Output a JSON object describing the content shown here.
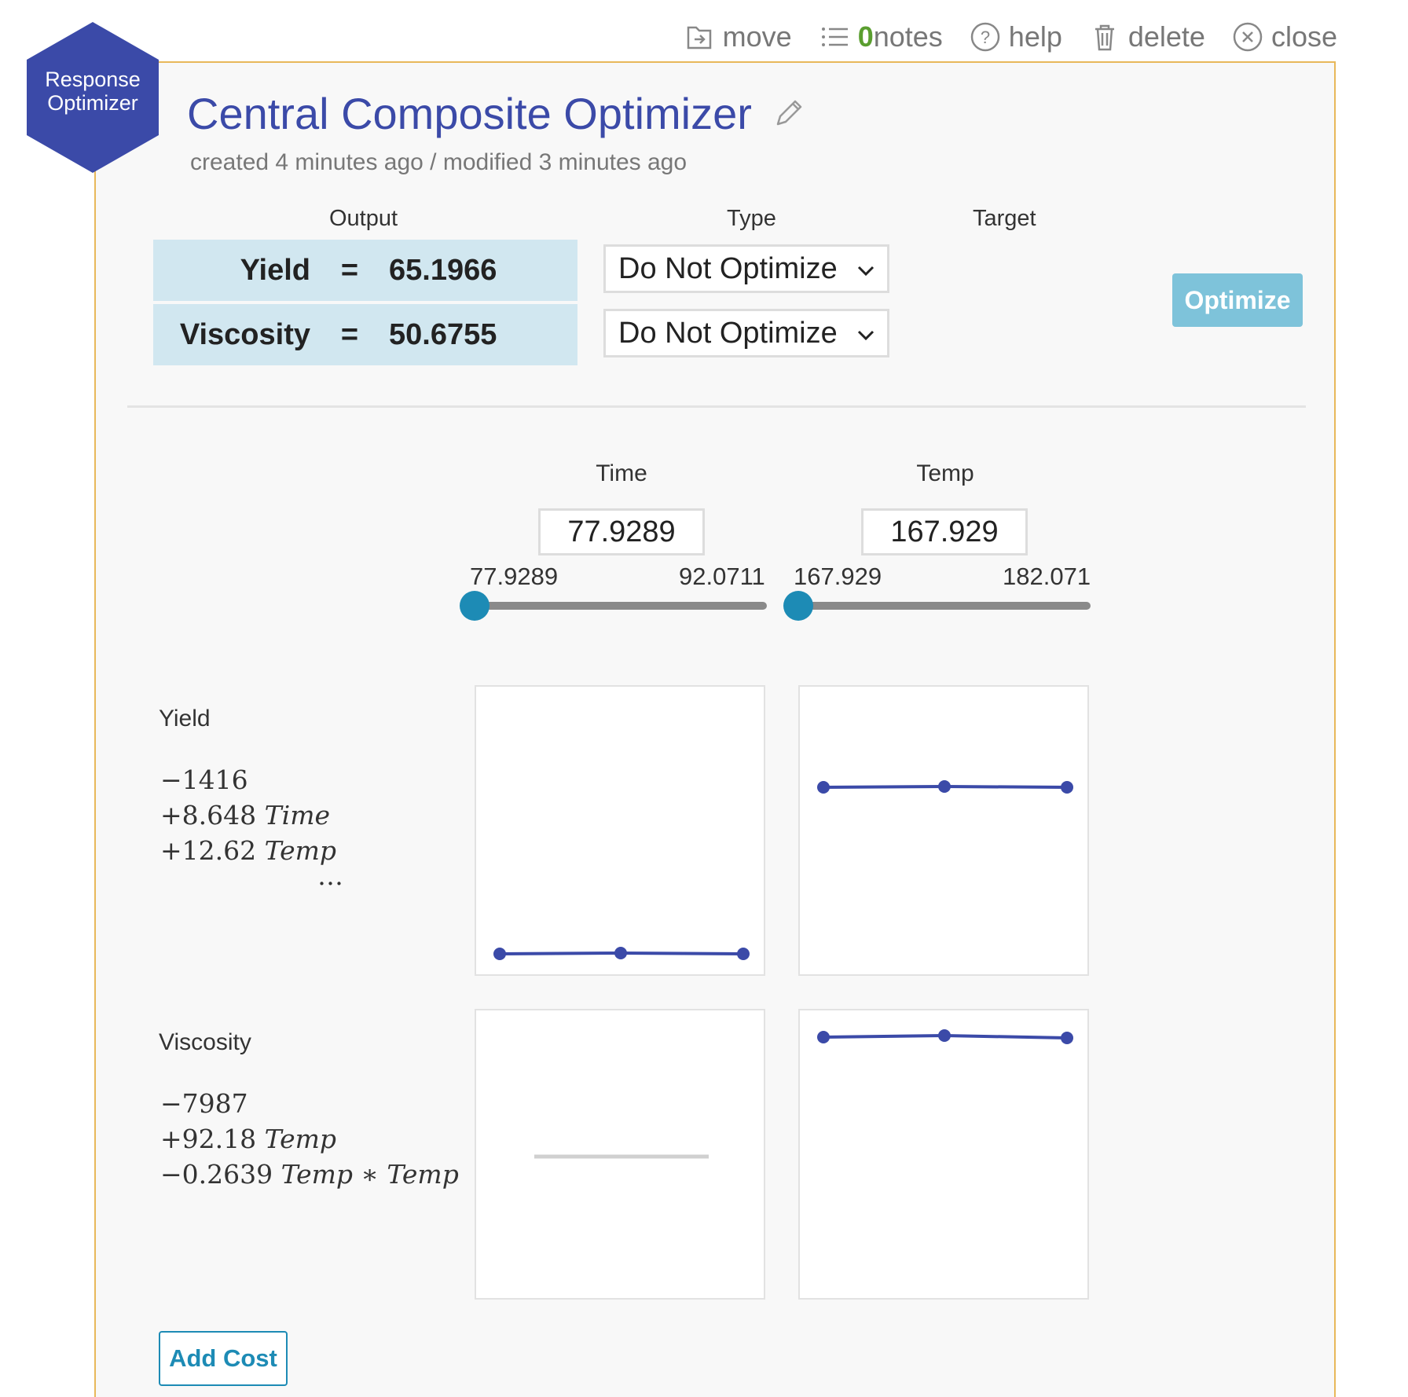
{
  "toolbar": {
    "move": "move",
    "notes_count": "0",
    "notes": "notes",
    "help": "help",
    "delete": "delete",
    "close": "close"
  },
  "badge": {
    "line1": "Response",
    "line2": "Optimizer",
    "icon": "wrench-icon",
    "color": "#3b4aa8"
  },
  "title": "Central Composite Optimizer",
  "subtitle": "created 4 minutes ago / modified 3 minutes ago",
  "headers": {
    "output": "Output",
    "type": "Type",
    "target": "Target"
  },
  "outputs": [
    {
      "name": "Yield",
      "eq": "=",
      "value": "65.1966",
      "type": "Do Not Optimize"
    },
    {
      "name": "Viscosity",
      "eq": "=",
      "value": "50.6755",
      "type": "Do Not Optimize"
    }
  ],
  "optimize_label": "Optimize",
  "factors": [
    {
      "name": "Time",
      "value": "77.9289",
      "min": "77.9289",
      "max": "92.0711",
      "position": 0
    },
    {
      "name": "Temp",
      "value": "167.929",
      "min": "167.929",
      "max": "182.071",
      "position": 0
    }
  ],
  "responses": [
    {
      "name": "Yield",
      "terms": [
        {
          "sign": "−",
          "coef": "1416",
          "var": ""
        },
        {
          "sign": "+",
          "coef": "8.648",
          "var": "Time"
        },
        {
          "sign": "+",
          "coef": "12.62",
          "var": "Temp"
        }
      ],
      "more": "…"
    },
    {
      "name": "Viscosity",
      "terms": [
        {
          "sign": "−",
          "coef": "7987",
          "var": ""
        },
        {
          "sign": "+",
          "coef": "92.18",
          "var": "Temp"
        },
        {
          "sign": "−",
          "coef": "0.2639",
          "var": "Temp ∗ Temp"
        }
      ],
      "more": ""
    }
  ],
  "add_cost_label": "Add Cost",
  "colors": {
    "accent": "#3b4aa8",
    "slider": "#1d8bb5",
    "output_bg": "#d1e7f0",
    "card_border": "#e8b85a"
  }
}
